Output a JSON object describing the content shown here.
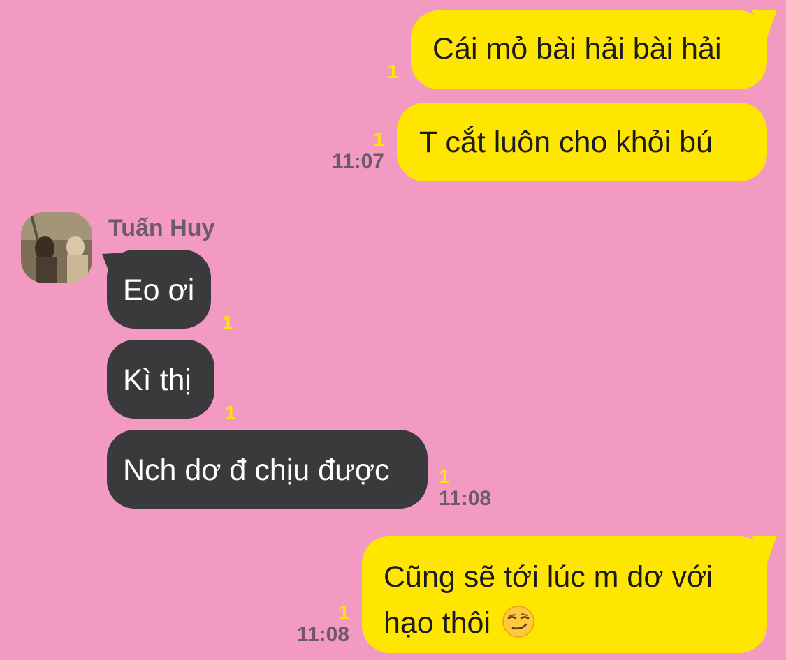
{
  "colors": {
    "background": "#F29AC2",
    "outgoing_bubble": "#FFE600",
    "incoming_bubble": "#3A3A3C",
    "read_count": "#FFE600",
    "timestamp": "#6E5A66"
  },
  "contact": {
    "name": "Tuấn Huy",
    "avatar_icon": "profile-photo"
  },
  "messages": [
    {
      "direction": "out",
      "text": "Cái mỏ bài hải bài hải",
      "unread": "1",
      "time": ""
    },
    {
      "direction": "out",
      "text": "T cắt luôn cho khỏi bú",
      "unread": "1",
      "time": "11:07"
    },
    {
      "direction": "in",
      "text": "Eo ơi",
      "unread": "1",
      "time": ""
    },
    {
      "direction": "in",
      "text": "Kì thị",
      "unread": "1",
      "time": ""
    },
    {
      "direction": "in",
      "text": "Nch dơ đ chịu được",
      "unread": "1",
      "time": "11:08"
    },
    {
      "direction": "out",
      "text": "Cũng sẽ tới lúc m dơ với hạo thôi",
      "emoji": "smirking-face",
      "unread": "1",
      "time": "11:08"
    }
  ]
}
